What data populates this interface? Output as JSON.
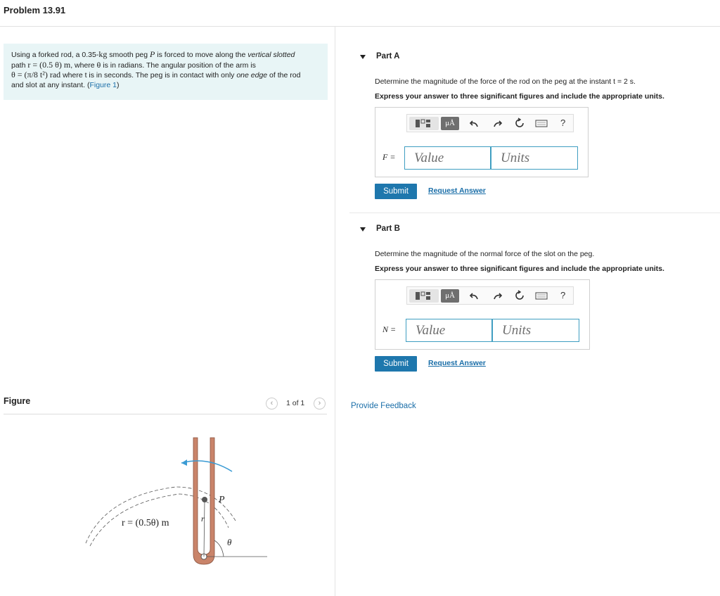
{
  "header": {
    "title": "Problem 13.91"
  },
  "problem": {
    "line1_pre": "Using a forked rod, a 0.35-",
    "mass_unit": "kg",
    "line1_mid": " smooth peg ",
    "peg": "P",
    "line1_mid2": " is forced to move along the ",
    "slotted": "vertical slotted",
    "line2_pre": "path ",
    "path_eq": "r = (0.5 θ) m",
    "line2_post": ", where θ is in radians. The angular position of the arm is",
    "line3_eq": "θ = (π/8 t²) rad",
    "line3_post": " where t is in seconds. The peg is in contact with only ",
    "one_edge": "one edge",
    "line3_tail": " of the rod",
    "line4": "and slot at any instant. (",
    "figure_link": "Figure 1",
    "line4_tail": ")"
  },
  "figure": {
    "label": "Figure",
    "pager": "1 of 1",
    "prev_icon": "chevron-left-icon",
    "next_icon": "chevron-right-icon",
    "eq_label": "r = (0.5θ) m",
    "p_label": "P",
    "r_label": "r",
    "theta_label": "θ"
  },
  "parts": {
    "a": {
      "title": "Part A",
      "prompt": "Determine the magnitude of the force of the rod on the peg at the instant t = 2 s.",
      "instruction": "Express your answer to three significant figures and include the appropriate units.",
      "variable": "F =",
      "value_placeholder": "Value",
      "units_placeholder": "Units",
      "submit": "Submit",
      "request": "Request Answer"
    },
    "b": {
      "title": "Part B",
      "prompt": "Determine the magnitude of the normal force of the slot on the peg.",
      "instruction": "Express your answer to three significant figures and include the appropriate units.",
      "variable": "N =",
      "value_placeholder": "Value",
      "units_placeholder": "Units",
      "submit": "Submit",
      "request": "Request Answer"
    }
  },
  "toolbar": {
    "mu_label": "μÅ",
    "help": "?",
    "icons": [
      "templates-icon",
      "units-icon",
      "undo-icon",
      "redo-icon",
      "reset-icon",
      "keyboard-icon",
      "help-icon"
    ]
  },
  "feedback": {
    "label": "Provide Feedback"
  },
  "colors": {
    "accent": "#1e77ad",
    "link": "#1a6ea8",
    "problem_bg": "#e8f5f6",
    "input_border": "#3f9ec1",
    "rod": "#c9846a",
    "arrow": "#3a9bd4"
  }
}
